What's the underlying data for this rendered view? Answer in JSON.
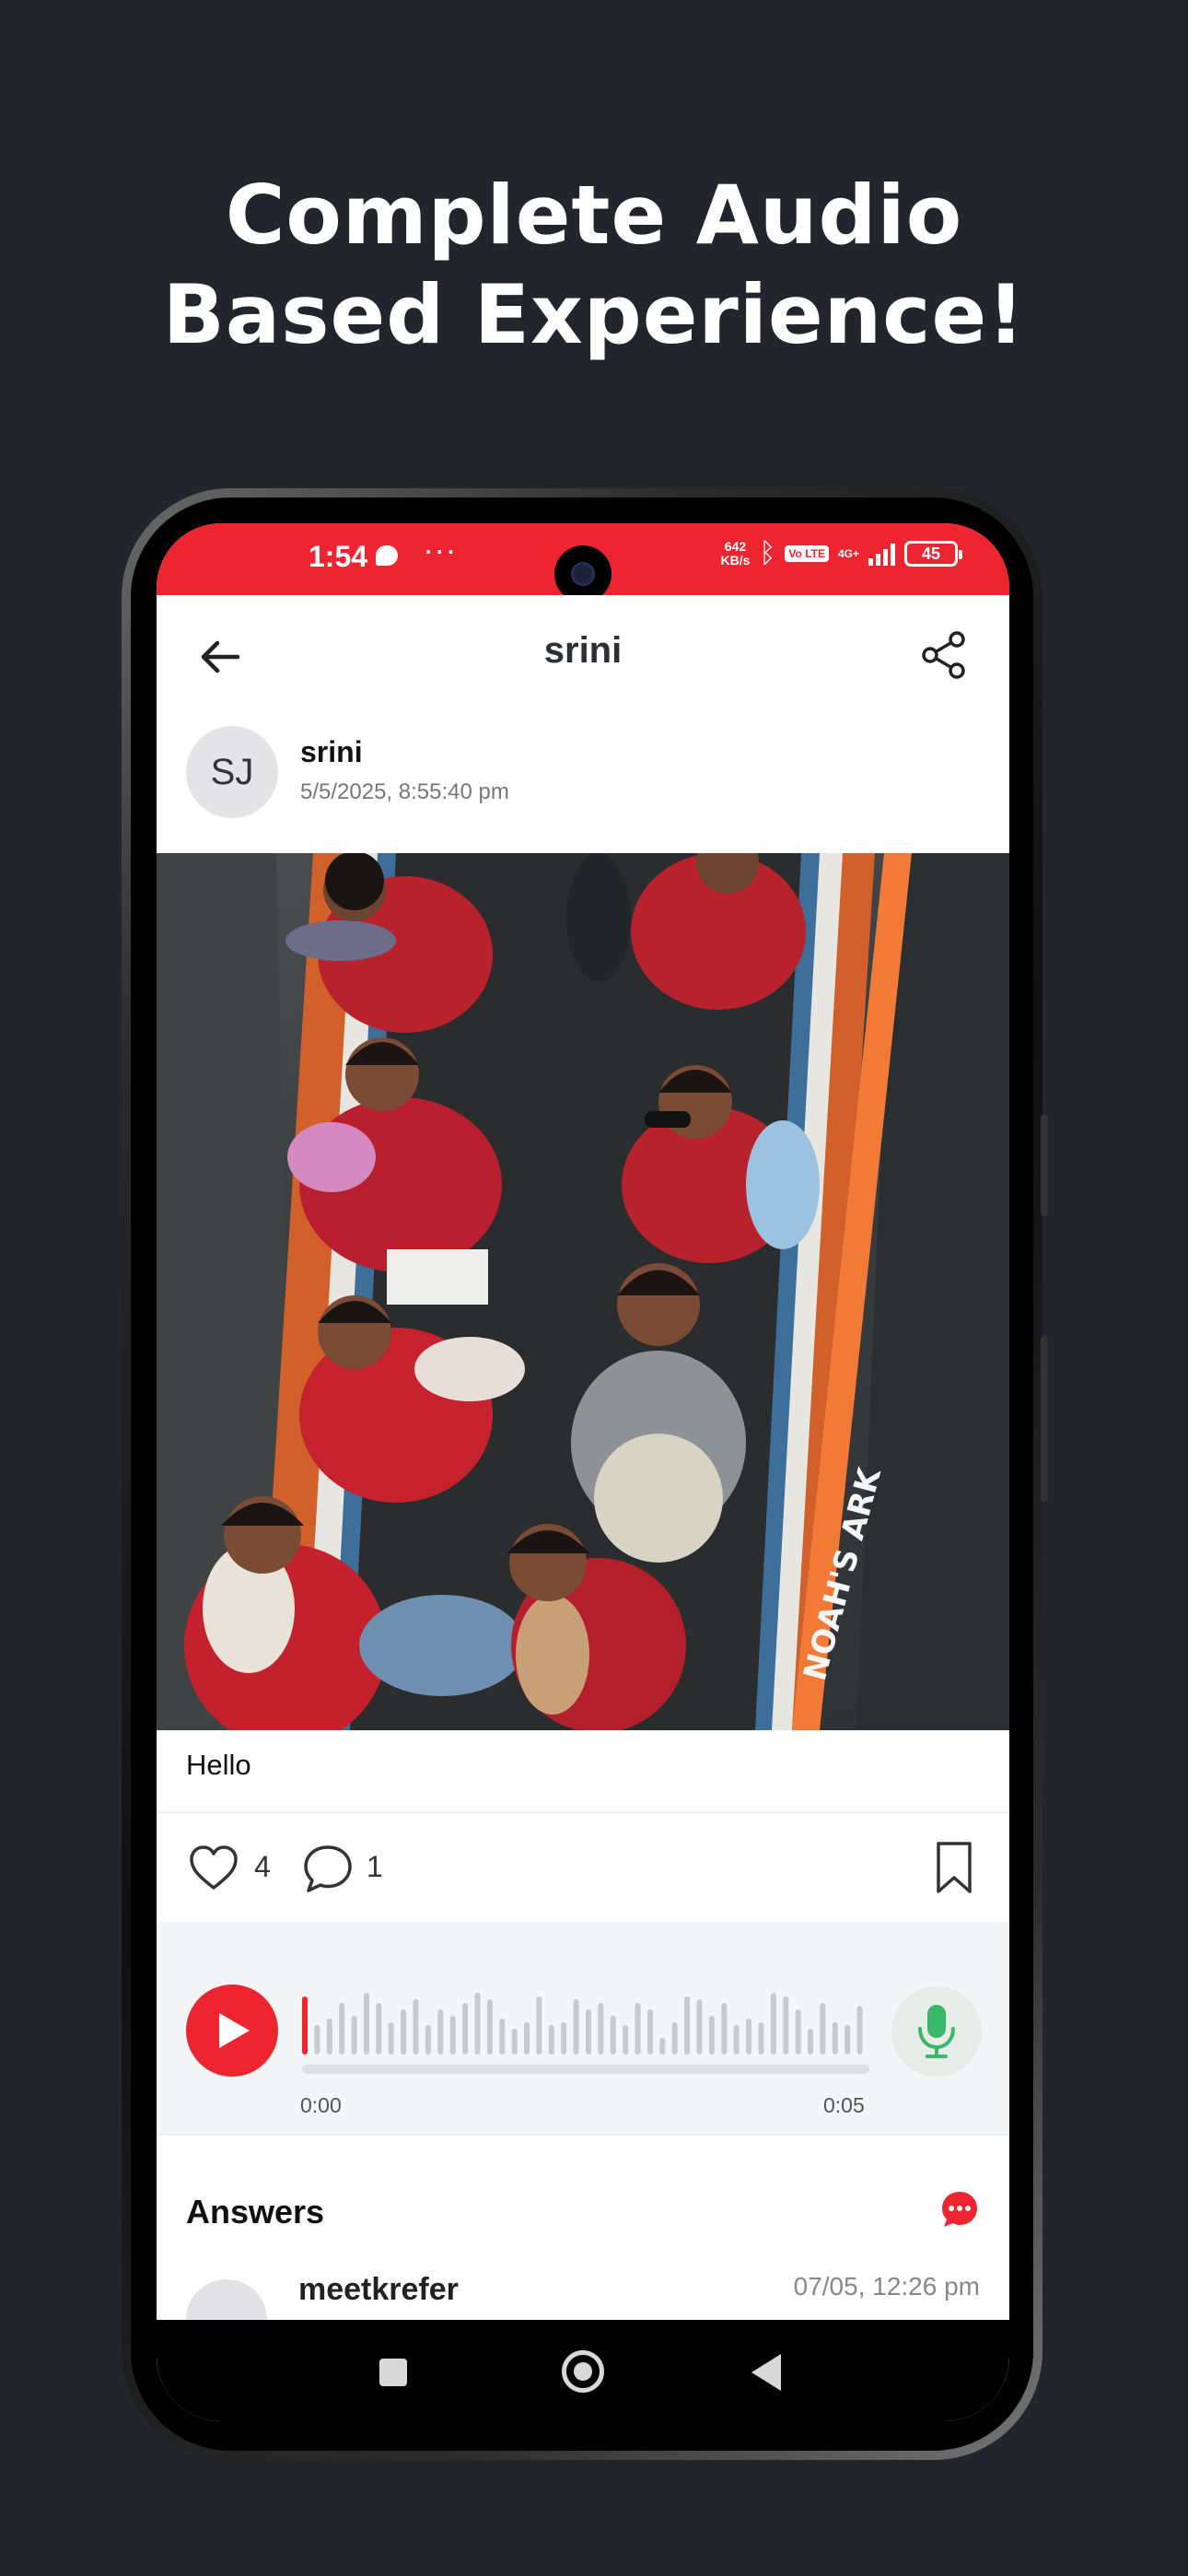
{
  "headline": {
    "line1": "Complete Audio",
    "line2": "Based Experience!"
  },
  "colors": {
    "accent": "#ec2530",
    "mic_green": "#39b86a",
    "background": "#22252c"
  },
  "status_bar": {
    "time": "1:54",
    "dots": "···",
    "speed_value": "642",
    "speed_unit": "KB/s",
    "volte": "Vo LTE",
    "network": "4G+",
    "battery": "45"
  },
  "app_bar": {
    "title": "srini",
    "back_icon": "arrow-left-icon",
    "share_icon": "share-icon"
  },
  "post": {
    "author_initials": "SJ",
    "author_name": "srini",
    "timestamp": "5/5/2025, 8:55:40 pm",
    "boat_text": "NOAH'S ARK",
    "caption": "Hello",
    "likes": "4",
    "comments": "1"
  },
  "audio": {
    "current_time": "0:00",
    "duration": "0:05",
    "progress": 0.0
  },
  "answers": {
    "title": "Answers",
    "items": [
      {
        "name": "meetkrefer",
        "time": "07/05, 12:26 pm"
      }
    ]
  },
  "nav_bar": {
    "recents": "square-icon",
    "home": "circle-icon",
    "back": "triangle-back-icon"
  }
}
